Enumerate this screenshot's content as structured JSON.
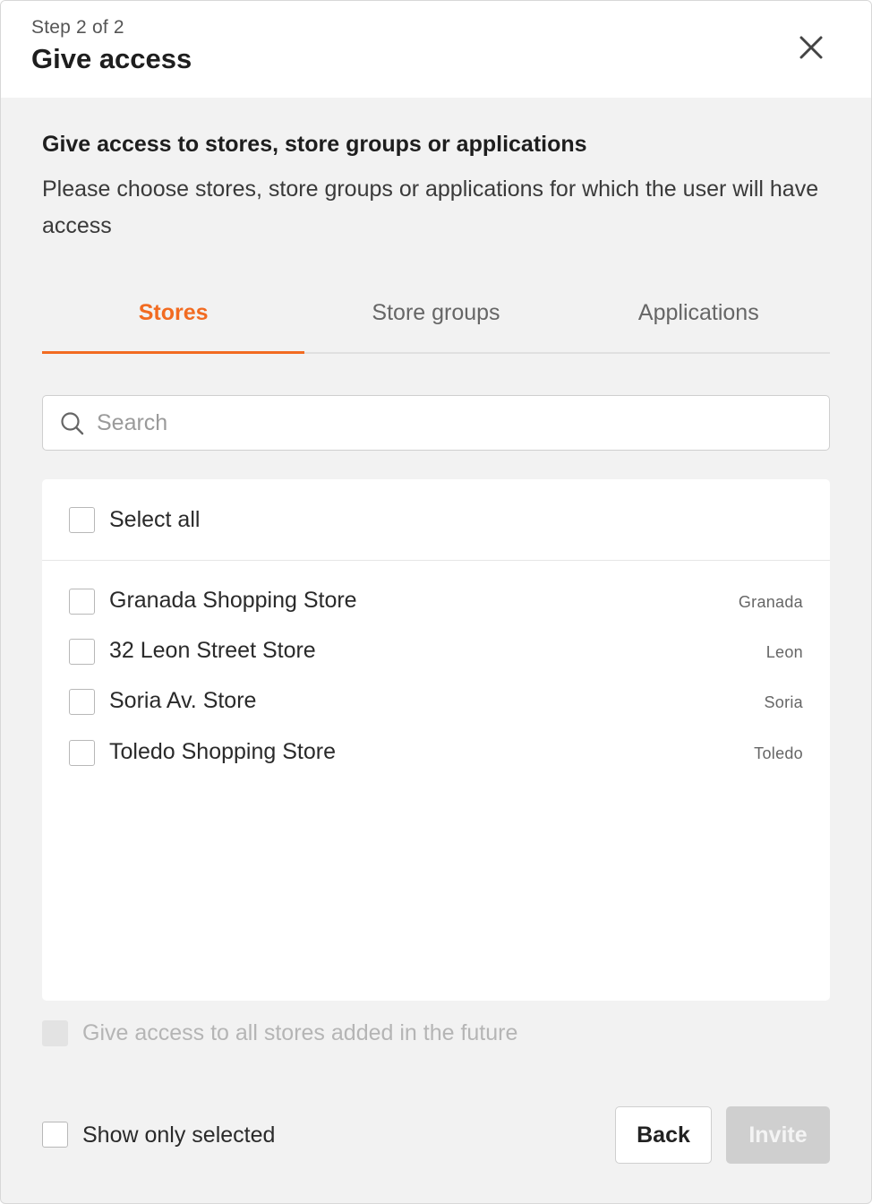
{
  "header": {
    "step": "Step 2 of 2",
    "title": "Give access"
  },
  "section": {
    "title": "Give access to stores, store groups or applications",
    "description": "Please choose stores, store groups or applications for which the user will have access"
  },
  "tabs": [
    {
      "label": "Stores",
      "active": true
    },
    {
      "label": "Store groups",
      "active": false
    },
    {
      "label": "Applications",
      "active": false
    }
  ],
  "search": {
    "placeholder": "Search",
    "value": ""
  },
  "list": {
    "select_all_label": "Select all",
    "stores": [
      {
        "name": "Granada Shopping Store",
        "city": "Granada",
        "checked": false
      },
      {
        "name": "32 Leon Street Store",
        "city": "Leon",
        "checked": false
      },
      {
        "name": "Soria Av. Store",
        "city": "Soria",
        "checked": false
      },
      {
        "name": "Toledo Shopping Store",
        "city": "Toledo",
        "checked": false
      }
    ]
  },
  "future_access_label": "Give access to all stores added in the future",
  "footer": {
    "show_selected_label": "Show only selected",
    "back_label": "Back",
    "invite_label": "Invite"
  },
  "colors": {
    "accent": "#f26b21",
    "panel_bg": "#f2f2f2",
    "disabled_button": "#cfcfcf"
  }
}
